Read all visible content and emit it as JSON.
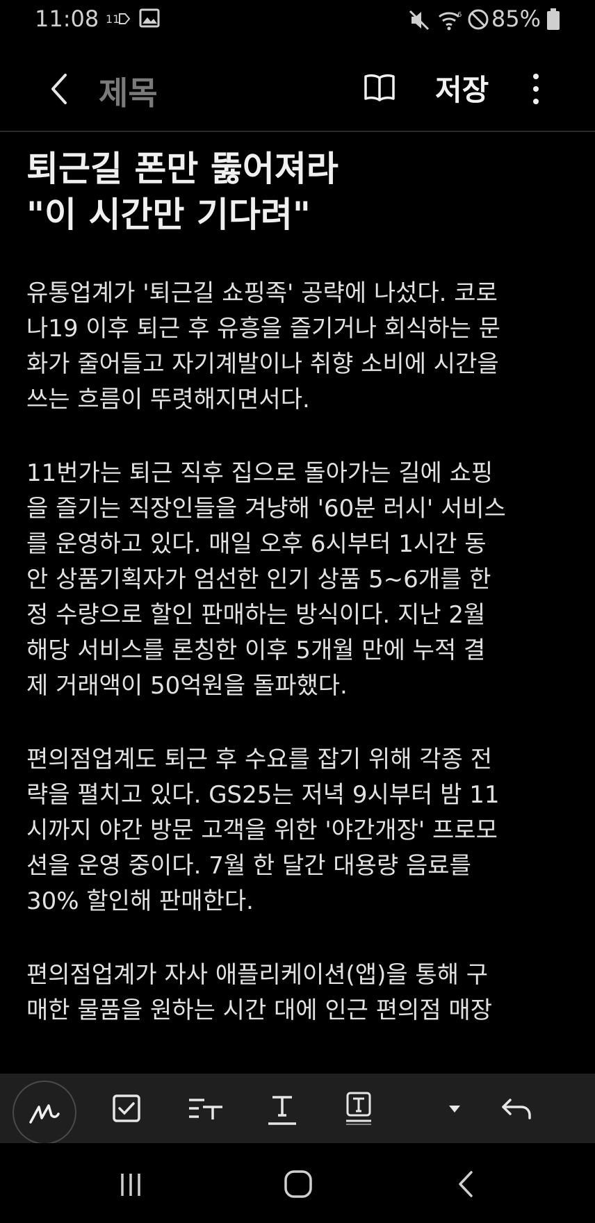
{
  "status": {
    "time": "11:08",
    "battery": "85%",
    "icons": [
      "notification-icon",
      "gallery-icon",
      "mute-icon",
      "wifi-icon",
      "dnd-icon",
      "battery-icon"
    ]
  },
  "appbar": {
    "title": "제목",
    "save_label": "저장",
    "icons": [
      "back-icon",
      "reader-mode-icon",
      "more-options-icon"
    ]
  },
  "note": {
    "headline": "퇴근길 폰만 뚫어져라\n\"이 시간만 기다려\"",
    "paragraphs": [
      "유통업계가 '퇴근길 쇼핑족' 공략에 나섰다. 코로\n나19 이후 퇴근 후 유흥을 즐기거나 회식하는 문\n화가 줄어들고 자기계발이나 취향 소비에 시간을\n쓰는 흐름이 뚜렷해지면서다.",
      " 11번가는 퇴근 직후 집으로 돌아가는 길에 쇼핑\n을 즐기는 직장인들을 겨냥해 '60분 러시' 서비스\n를 운영하고 있다. 매일 오후 6시부터 1시간 동\n안 상품기획자가 엄선한 인기 상품 5~6개를 한\n정 수량으로 할인 판매하는 방식이다. 지난 2월\n해당 서비스를 론칭한 이후 5개월 만에 누적 결\n제 거래액이 50억원을 돌파했다.",
      "편의점업계도 퇴근 후 수요를 잡기 위해 각종 전\n략을 펼치고 있다. GS25는 저녁 9시부터 밤 11\n시까지 야간 방문 고객을 위한 '야간개장' 프로모\n션을 운영 중이다. 7월 한 달간 대용량 음료를\n30% 할인해 판매한다.",
      "편의점업계가 자사 애플리케이션(앱)을 통해 구\n매한 물품을 원하는 시간 대에 인근 편의점 매장"
    ]
  },
  "toolbar": {
    "tools": [
      "pen-icon",
      "checkbox-icon",
      "text-format-icon",
      "text-underline-icon",
      "text-box-icon",
      "dropdown-icon",
      "undo-icon"
    ]
  },
  "navbar": {
    "buttons": [
      "recent-apps-icon",
      "home-icon",
      "back-nav-icon"
    ]
  }
}
